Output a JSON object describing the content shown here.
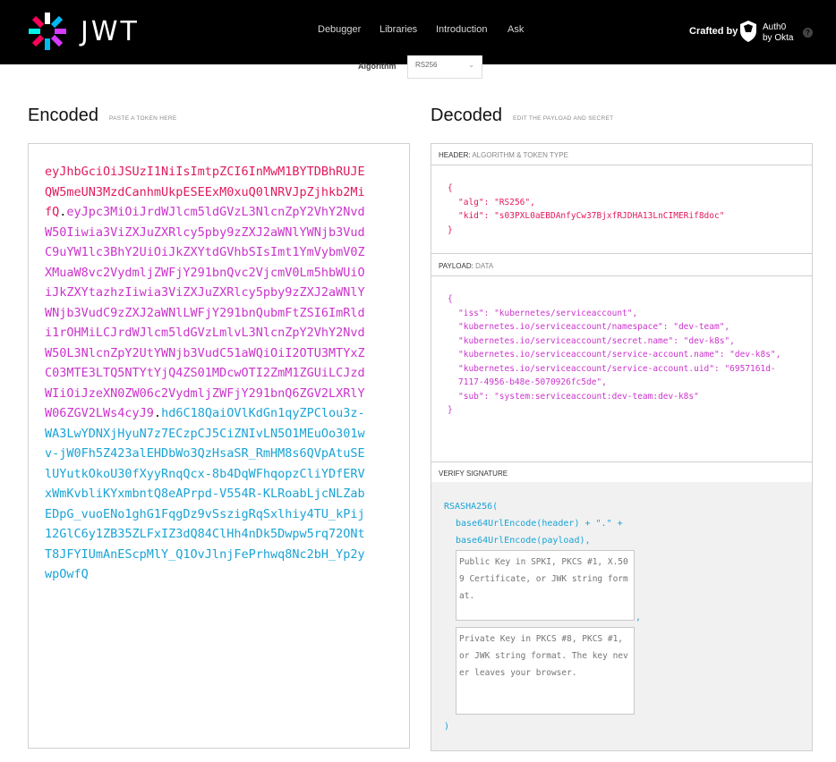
{
  "brand": {
    "name": "JWT"
  },
  "nav": {
    "links": [
      "Debugger",
      "Libraries",
      "Introduction",
      "Ask"
    ],
    "crafted_by": "Crafted by",
    "partner_line1": "Auth0",
    "partner_line2": "by Okta",
    "help": "?"
  },
  "algorithm": {
    "label": "Algorithm",
    "value": "RS256"
  },
  "encoded": {
    "title": "Encoded",
    "subtitle": "PASTE A TOKEN HERE",
    "header_part": "eyJhbGciOiJSUzI1NiIsImtpZCI6InMwM1BYTDBhRUJEQW5meUN3MzdCanhmUkpESEExM0xuQ0lNRVJpZjhkb2MifQ",
    "payload_part": "eyJpc3MiOiJrdWJlcm5ldGVzL3NlcnZpY2VhY2NvdW50Iiwia3ViZXJuZXRlcy5pby9zZXJ2aWNlYWNjb3VudC9uYW1lc3BhY2UiOiJkZXYtdGVhbSIsImt1YmVybmV0ZXMuaW8vc2VydmljZWFjY291bnQvc2VjcmV0Lm5hbWUiOiJkZXYtazhzIiwia3ViZXJuZXRlcy5pby9zZXJ2aWNlYWNjb3VudC9zZXJ2aWNlLWFjY291bnQubmFtZSI6ImRldi1rOHMiLCJrdWJlcm5ldGVzLmlvL3NlcnZpY2VhY2NvdW50L3NlcnZpY2UtYWNjb3VudC51aWQiOiI2OTU3MTYxZC03MTE3LTQ5NTYtYjQ4ZS01MDcwOTI2ZmM1ZGUiLCJzdWIiOiJzeXN0ZW06c2VydmljZWFjY291bnQ6ZGV2LXRlYW06ZGV2LWs4cyJ9",
    "signature_part": "hd6C18QaiOVlKdGn1qyZPClou3z-WA3LwYDNXjHyuN7z7ECzpCJ5CiZNIvLN5O1MEuOo301wv-jW0Fh5Z423alEHDbWo3QzHsaSR_RmHM8s6QVpAtuSElUYutkOkoU30fXyyRnqQcx-8b4DqWFhqopzCliYDfERVxWmKvbliKYxmbntQ8eAPrpd-V554R-KLRoabLjcNLZabEDpG_vuoENo1ghG1FqgDz9vSszigRqSxlhiy4TU_kPij12GlC6y1ZB35ZLFxIZ3dQ84ClHh4nDk5Dwpw5rq72ONtT8JFYIUmAnEScpMlY_Q1OvJlnjFePrhwq8Nc2bH_Yp2ywpOwfQ",
    "dot": "."
  },
  "decoded": {
    "title": "Decoded",
    "subtitle": "EDIT THE PAYLOAD AND SECRET",
    "header_section": {
      "label": "HEADER:",
      "sublabel": "ALGORITHM & TOKEN TYPE"
    },
    "payload_section": {
      "label": "PAYLOAD:",
      "sublabel": "DATA"
    },
    "signature_section": {
      "label": "VERIFY SIGNATURE"
    },
    "header_json": {
      "open": "{",
      "alg_key": "\"alg\"",
      "alg_val": "\"RS256\"",
      "kid_key": "\"kid\"",
      "kid_val": "\"s03PXL0aEBDAnfyCw37BjxfRJDHA13LnCIMERif8doc\"",
      "close": "}"
    },
    "payload_json": {
      "open": "{",
      "lines": [
        {
          "key": "\"iss\"",
          "val": "\"kubernetes/serviceaccount\","
        },
        {
          "key": "\"kubernetes.io/serviceaccount/namespace\"",
          "val": "\"dev-team\","
        },
        {
          "key": "\"kubernetes.io/serviceaccount/secret.name\"",
          "val": "\"dev-k8s\","
        },
        {
          "key": "\"kubernetes.io/serviceaccount/service-account.name\"",
          "val": "\"dev-k8s\","
        },
        {
          "key": "\"kubernetes.io/serviceaccount/service-account.uid\"",
          "val": "\"6957161d-7117-4956-b48e-5070926fc5de\","
        },
        {
          "key": "\"sub\"",
          "val": "\"system:serviceaccount:dev-team:dev-k8s\""
        }
      ],
      "close": "}"
    },
    "signature": {
      "line1": "RSASHA256(",
      "line2": "base64UrlEncode(header) + \".\" +",
      "line3": "base64UrlEncode(payload),",
      "public_key_placeholder": "Public Key in SPKI, PKCS #1, X.509 Certificate, or JWK string format.",
      "comma": ",",
      "private_key_placeholder": "Private Key in PKCS #8, PKCS #1, or JWK string format. The key never leaves your browser.",
      "close": ")"
    }
  }
}
